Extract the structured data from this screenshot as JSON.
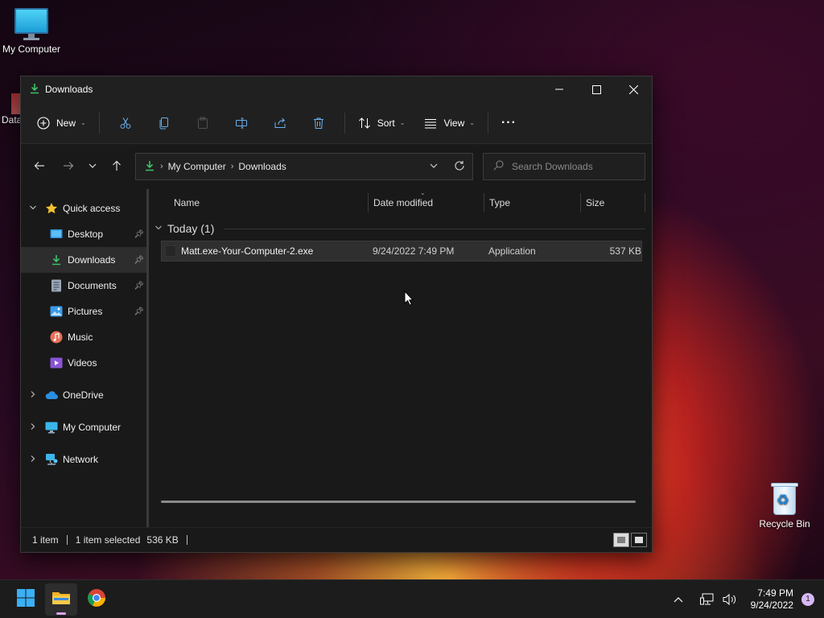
{
  "desktop": {
    "my_computer_label": "My Computer",
    "partial_label": "Data",
    "recycle_bin_label": "Recycle Bin"
  },
  "window": {
    "title": "Downloads",
    "toolbar": {
      "new_label": "New",
      "sort_label": "Sort",
      "view_label": "View",
      "more_label": "···"
    },
    "address": {
      "crumbs": [
        "My Computer",
        "Downloads"
      ]
    },
    "search": {
      "placeholder": "Search Downloads"
    },
    "sidebar": {
      "quick_access": "Quick access",
      "items": [
        {
          "label": "Desktop",
          "icon": "desktop-icon",
          "pinned": true
        },
        {
          "label": "Downloads",
          "icon": "download-icon",
          "pinned": true,
          "selected": true
        },
        {
          "label": "Documents",
          "icon": "documents-icon",
          "pinned": true
        },
        {
          "label": "Pictures",
          "icon": "pictures-icon",
          "pinned": true
        },
        {
          "label": "Music",
          "icon": "music-icon",
          "pinned": false
        },
        {
          "label": "Videos",
          "icon": "videos-icon",
          "pinned": false
        }
      ],
      "onedrive": "OneDrive",
      "my_computer": "My Computer",
      "network": "Network"
    },
    "columns": {
      "name": "Name",
      "date": "Date modified",
      "type": "Type",
      "size": "Size"
    },
    "group": {
      "label": "Today (1)"
    },
    "files": [
      {
        "name": "Matt.exe-Your-Computer-2.exe",
        "date": "9/24/2022 7:49 PM",
        "type": "Application",
        "size": "537 KB"
      }
    ],
    "status": {
      "count": "1 item",
      "selected": "1 item selected",
      "size": "536 KB"
    }
  },
  "taskbar": {
    "time": "7:49 PM",
    "date": "9/24/2022",
    "notifications": "1"
  },
  "colors": {
    "accent_green": "#3fbf6a",
    "selection": "#2f2f2f",
    "notif_badge": "#d7b8f5"
  }
}
